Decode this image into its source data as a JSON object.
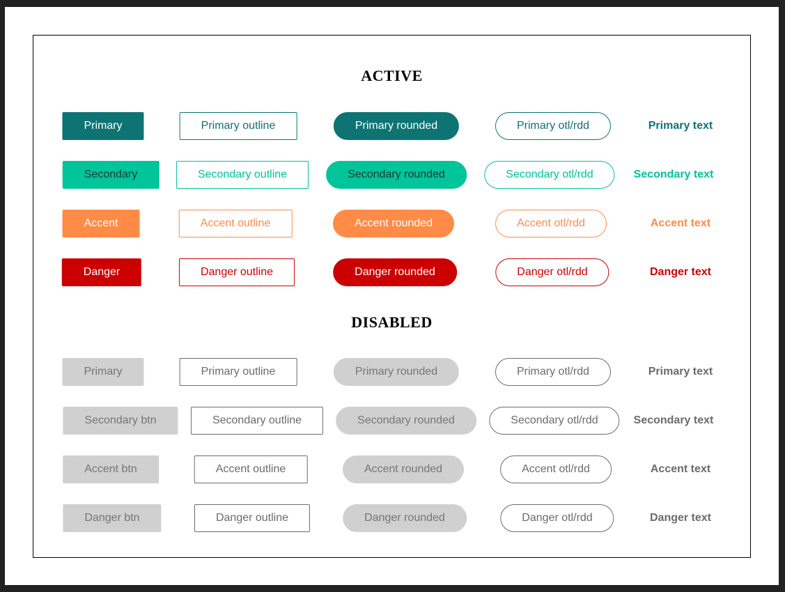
{
  "colors": {
    "primary": "#0e7373",
    "secondary": "#00c49a",
    "secondary_solid_text": "#1f3a33",
    "accent": "#ff8b47",
    "danger": "#cc0000",
    "disabled_bg": "#d0d0d0",
    "disabled_text": "#757575"
  },
  "sections": {
    "active_title": "ACTIVE",
    "disabled_title": "DISABLED"
  },
  "active": [
    {
      "variant": "primary",
      "solid": "Primary",
      "outline": "Primary outline",
      "rounded": "Primary rounded",
      "outline_rounded": "Primary otl/rdd",
      "text": "Primary text"
    },
    {
      "variant": "secondary",
      "solid": "Secondary",
      "outline": "Secondary outline",
      "rounded": "Secondary rounded",
      "outline_rounded": "Secondary otl/rdd",
      "text": "Secondary text"
    },
    {
      "variant": "accent",
      "solid": "Accent",
      "outline": "Accent outline",
      "rounded": "Accent rounded",
      "outline_rounded": "Accent otl/rdd",
      "text": "Accent text"
    },
    {
      "variant": "danger",
      "solid": "Danger",
      "outline": "Danger outline",
      "rounded": "Danger rounded",
      "outline_rounded": "Danger otl/rdd",
      "text": "Danger text"
    }
  ],
  "disabled": [
    {
      "variant": "primary",
      "solid": "Primary",
      "outline": "Primary outline",
      "rounded": "Primary rounded",
      "outline_rounded": "Primary otl/rdd",
      "text": "Primary text"
    },
    {
      "variant": "secondary",
      "solid": "Secondary btn",
      "outline": "Secondary outline",
      "rounded": "Secondary rounded",
      "outline_rounded": "Secondary otl/rdd",
      "text": "Secondary text"
    },
    {
      "variant": "accent",
      "solid": "Accent btn",
      "outline": "Accent outline",
      "rounded": "Accent rounded",
      "outline_rounded": "Accent otl/rdd",
      "text": "Accent text"
    },
    {
      "variant": "danger",
      "solid": "Danger btn",
      "outline": "Danger outline",
      "rounded": "Danger rounded",
      "outline_rounded": "Danger otl/rdd",
      "text": "Danger text"
    }
  ]
}
